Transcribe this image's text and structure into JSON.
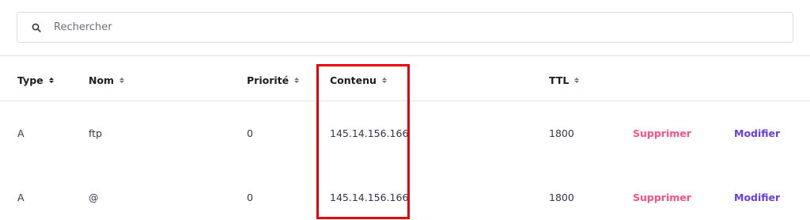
{
  "search": {
    "placeholder": "Rechercher",
    "icon": "search-icon"
  },
  "table": {
    "columns": [
      {
        "key": "type",
        "label": "Type"
      },
      {
        "key": "nom",
        "label": "Nom"
      },
      {
        "key": "priorite",
        "label": "Priorité"
      },
      {
        "key": "contenu",
        "label": "Contenu"
      },
      {
        "key": "ttl",
        "label": "TTL"
      }
    ],
    "rows": [
      {
        "type": "A",
        "nom": "ftp",
        "priorite": "0",
        "contenu": "145.14.156.166",
        "ttl": "1800",
        "delete_label": "Supprimer",
        "edit_label": "Modifier"
      },
      {
        "type": "A",
        "nom": "@",
        "priorite": "0",
        "contenu": "145.14.156.166",
        "ttl": "1800",
        "delete_label": "Supprimer",
        "edit_label": "Modifier"
      }
    ]
  },
  "colors": {
    "delete": "#fc5185",
    "edit": "#673de6",
    "highlight": "#e8000b"
  }
}
